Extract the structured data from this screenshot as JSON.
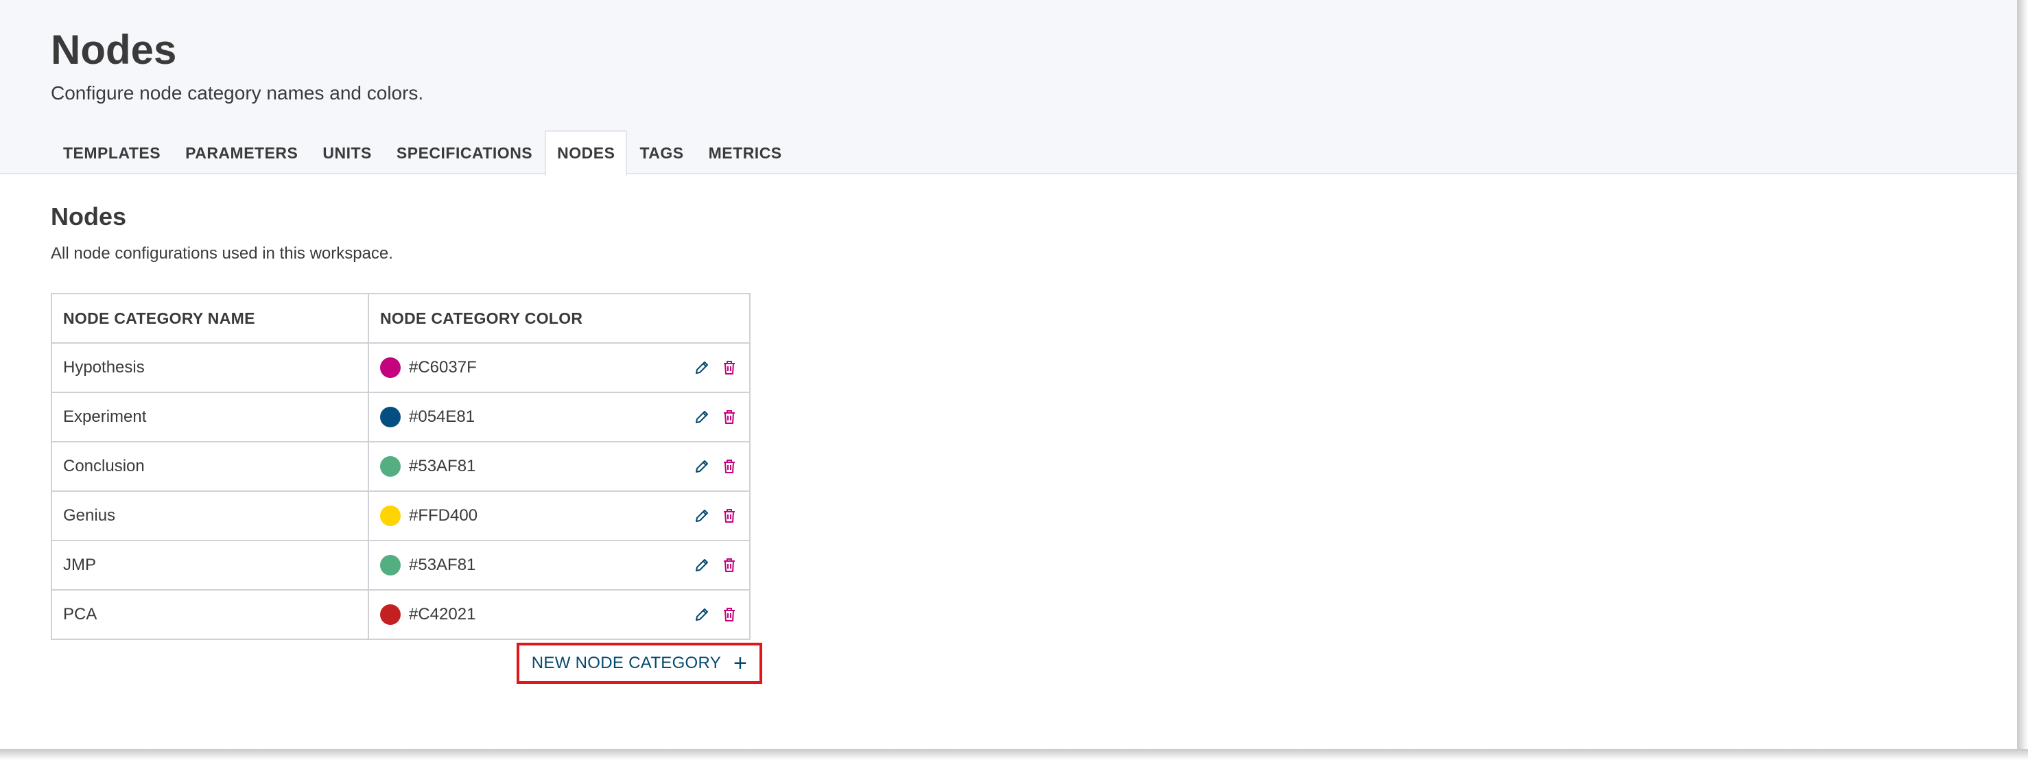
{
  "page": {
    "title": "Nodes",
    "subtitle": "Configure node category names and colors."
  },
  "tabs": [
    {
      "label": "TEMPLATES",
      "active": false
    },
    {
      "label": "PARAMETERS",
      "active": false
    },
    {
      "label": "UNITS",
      "active": false
    },
    {
      "label": "SPECIFICATIONS",
      "active": false
    },
    {
      "label": "NODES",
      "active": true
    },
    {
      "label": "TAGS",
      "active": false
    },
    {
      "label": "METRICS",
      "active": false
    }
  ],
  "section": {
    "title": "Nodes",
    "description": "All node configurations used in this workspace."
  },
  "table": {
    "headers": [
      "NODE CATEGORY NAME",
      "NODE CATEGORY COLOR"
    ],
    "rows": [
      {
        "name": "Hypothesis",
        "color": "#C6037F"
      },
      {
        "name": "Experiment",
        "color": "#054E81"
      },
      {
        "name": "Conclusion",
        "color": "#53AF81"
      },
      {
        "name": "Genius",
        "color": "#FFD400"
      },
      {
        "name": "JMP",
        "color": "#53AF81"
      },
      {
        "name": "PCA",
        "color": "#C42021"
      }
    ],
    "row_icons": [
      "pencil-icon",
      "trash-icon"
    ]
  },
  "new_button": {
    "label": "NEW NODE CATEGORY",
    "icon": "plus-icon"
  },
  "colors": {
    "edit_icon": "#05486f",
    "delete_icon": "#c6037f",
    "highlight_border": "#e0161b",
    "header_bg": "#f6f7fa"
  }
}
